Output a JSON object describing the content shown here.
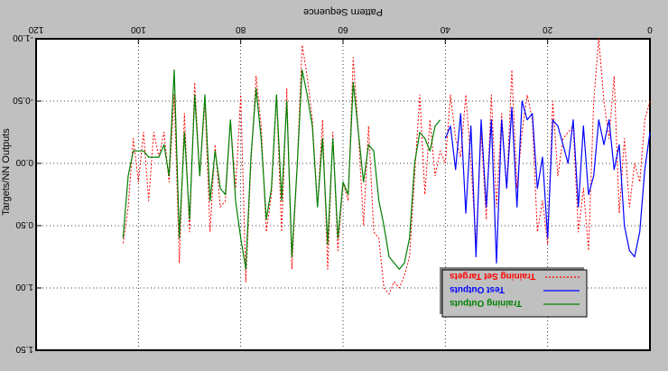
{
  "chart_data": {
    "type": "line",
    "title": "Pattern Sequence",
    "xlabel": "",
    "ylabel": "Targets/NN Outputs",
    "xlim": [
      0,
      120
    ],
    "ylim": [
      -1.0,
      1.5
    ],
    "x_ticks": [
      "0",
      "20",
      "40",
      "60",
      "80",
      "100",
      "120"
    ],
    "y_ticks": [
      "-1.00",
      "-0.50",
      "0.00",
      "0.50",
      "1.00",
      "1.50"
    ],
    "grid": true,
    "legend_position": "bottom-right",
    "legend": [
      {
        "name": "Training Set Targets",
        "color": "#ff0000",
        "style": "dotted"
      },
      {
        "name": "Test Outputs",
        "color": "#0000ff",
        "style": "solid"
      },
      {
        "name": "Training Outputs",
        "color": "#008000",
        "style": "solid"
      }
    ],
    "series": [
      {
        "name": "Training Set Targets",
        "color": "#ff0000",
        "style": "dotted",
        "points": [
          [
            0,
            -0.5
          ],
          [
            1,
            -0.35
          ],
          [
            2,
            0.15
          ],
          [
            3,
            0.0
          ],
          [
            4,
            0.35
          ],
          [
            5,
            -0.2
          ],
          [
            6,
            0.4
          ],
          [
            7,
            -0.7
          ],
          [
            8,
            -0.2
          ],
          [
            9,
            -0.5
          ],
          [
            10,
            -1.0
          ],
          [
            11,
            -0.5
          ],
          [
            12,
            0.7
          ],
          [
            13,
            0.2
          ],
          [
            14,
            0.55
          ],
          [
            15,
            -0.3
          ],
          [
            16,
            -0.25
          ],
          [
            17,
            -0.2
          ],
          [
            18,
            0.1
          ],
          [
            19,
            -0.5
          ],
          [
            20,
            0.65
          ],
          [
            21,
            0.3
          ],
          [
            22,
            0.55
          ],
          [
            23,
            -0.35
          ],
          [
            24,
            -0.55
          ],
          [
            25,
            -0.25
          ],
          [
            26,
            0.2
          ],
          [
            27,
            -0.75
          ],
          [
            28,
            0.2
          ],
          [
            29,
            -0.4
          ],
          [
            30,
            0.35
          ],
          [
            31,
            -0.55
          ],
          [
            32,
            0.45
          ],
          [
            33,
            -0.25
          ],
          [
            34,
            0.65
          ],
          [
            35,
            0.0
          ],
          [
            36,
            -0.55
          ],
          [
            37,
            -0.05
          ],
          [
            38,
            -0.2
          ],
          [
            39,
            -0.55
          ],
          [
            40,
            0.0
          ],
          [
            41,
            -0.1
          ],
          [
            42,
            0.1
          ],
          [
            43,
            -0.35
          ],
          [
            44,
            0.25
          ],
          [
            45,
            -0.55
          ],
          [
            46,
            0.1
          ],
          [
            47,
            0.75
          ],
          [
            48,
            0.9
          ],
          [
            49,
            1.0
          ],
          [
            50,
            0.95
          ],
          [
            51,
            1.05
          ],
          [
            52,
            1.0
          ],
          [
            53,
            0.6
          ],
          [
            54,
            0.55
          ],
          [
            55,
            -0.3
          ],
          [
            56,
            0.5
          ],
          [
            57,
            -0.25
          ],
          [
            58,
            -0.85
          ],
          [
            59,
            0.3
          ],
          [
            60,
            0.15
          ],
          [
            61,
            0.7
          ],
          [
            62,
            -0.25
          ],
          [
            63,
            0.85
          ],
          [
            64,
            -0.35
          ],
          [
            65,
            0.35
          ],
          [
            66,
            -0.35
          ],
          [
            67,
            -0.7
          ],
          [
            68,
            -0.95
          ],
          [
            69,
            0.05
          ],
          [
            70,
            0.85
          ],
          [
            71,
            -0.6
          ],
          [
            72,
            0.55
          ],
          [
            73,
            -0.55
          ],
          [
            74,
            0.25
          ],
          [
            75,
            0.55
          ],
          [
            76,
            -0.3
          ],
          [
            77,
            -0.7
          ],
          [
            78,
            0.0
          ],
          [
            79,
            0.95
          ],
          [
            80,
            -0.55
          ],
          [
            81,
            0.2
          ],
          [
            82,
            -0.35
          ],
          [
            83,
            0.3
          ],
          [
            84,
            0.35
          ],
          [
            85,
            -0.15
          ],
          [
            86,
            0.55
          ],
          [
            87,
            -0.5
          ],
          [
            88,
            0.1
          ],
          [
            89,
            -0.65
          ],
          [
            90,
            0.55
          ],
          [
            91,
            -0.4
          ],
          [
            92,
            0.8
          ],
          [
            93,
            -0.55
          ],
          [
            94,
            0.15
          ],
          [
            95,
            -0.25
          ],
          [
            96,
            -0.05
          ],
          [
            97,
            -0.25
          ],
          [
            98,
            0.3
          ],
          [
            99,
            -0.25
          ],
          [
            100,
            0.15
          ],
          [
            101,
            -0.2
          ],
          [
            102,
            0.35
          ],
          [
            103,
            0.65
          ]
        ]
      },
      {
        "name": "Test Outputs",
        "color": "#0000ff",
        "style": "solid",
        "points": [
          [
            0,
            -0.25
          ],
          [
            1,
            0.05
          ],
          [
            2,
            0.55
          ],
          [
            3,
            0.75
          ],
          [
            4,
            0.7
          ],
          [
            5,
            0.5
          ],
          [
            6,
            -0.15
          ],
          [
            7,
            0.05
          ],
          [
            8,
            -0.35
          ],
          [
            9,
            -0.15
          ],
          [
            10,
            -0.35
          ],
          [
            11,
            0.1
          ],
          [
            12,
            0.25
          ],
          [
            13,
            -0.3
          ],
          [
            14,
            0.35
          ],
          [
            15,
            -0.35
          ],
          [
            16,
            0.0
          ],
          [
            17,
            -0.15
          ],
          [
            18,
            -0.3
          ],
          [
            19,
            -0.35
          ],
          [
            20,
            0.6
          ],
          [
            21,
            -0.05
          ],
          [
            22,
            0.2
          ],
          [
            23,
            -0.4
          ],
          [
            24,
            -0.35
          ],
          [
            25,
            -0.5
          ],
          [
            26,
            0.35
          ],
          [
            27,
            -0.45
          ],
          [
            28,
            0.2
          ],
          [
            29,
            -0.35
          ],
          [
            30,
            0.8
          ],
          [
            31,
            -0.35
          ],
          [
            32,
            0.35
          ],
          [
            33,
            -0.35
          ],
          [
            34,
            0.75
          ],
          [
            35,
            -0.3
          ],
          [
            36,
            0.4
          ],
          [
            37,
            -0.4
          ],
          [
            38,
            0.05
          ],
          [
            39,
            -0.3
          ],
          [
            40,
            -0.2
          ]
        ]
      },
      {
        "name": "Training Outputs",
        "color": "#008000",
        "style": "solid",
        "points": [
          [
            41,
            -0.35
          ],
          [
            42,
            -0.3
          ],
          [
            43,
            -0.1
          ],
          [
            44,
            -0.2
          ],
          [
            45,
            -0.25
          ],
          [
            46,
            0.0
          ],
          [
            47,
            0.6
          ],
          [
            48,
            0.8
          ],
          [
            49,
            0.85
          ],
          [
            50,
            0.8
          ],
          [
            51,
            0.75
          ],
          [
            52,
            0.5
          ],
          [
            53,
            0.3
          ],
          [
            54,
            -0.1
          ],
          [
            55,
            -0.15
          ],
          [
            56,
            0.15
          ],
          [
            57,
            -0.25
          ],
          [
            58,
            -0.65
          ],
          [
            59,
            0.25
          ],
          [
            60,
            0.15
          ],
          [
            61,
            0.6
          ],
          [
            62,
            -0.2
          ],
          [
            63,
            0.65
          ],
          [
            64,
            -0.2
          ],
          [
            65,
            0.35
          ],
          [
            66,
            -0.3
          ],
          [
            67,
            -0.55
          ],
          [
            68,
            -0.75
          ],
          [
            69,
            0.05
          ],
          [
            70,
            0.75
          ],
          [
            71,
            -0.5
          ],
          [
            72,
            0.3
          ],
          [
            73,
            -0.55
          ],
          [
            74,
            0.2
          ],
          [
            75,
            0.45
          ],
          [
            76,
            -0.2
          ],
          [
            77,
            -0.6
          ],
          [
            78,
            -0.05
          ],
          [
            79,
            0.85
          ],
          [
            80,
            0.6
          ],
          [
            81,
            0.3
          ],
          [
            82,
            -0.35
          ],
          [
            83,
            0.25
          ],
          [
            84,
            0.2
          ],
          [
            85,
            -0.1
          ],
          [
            86,
            0.3
          ],
          [
            87,
            -0.55
          ],
          [
            88,
            0.1
          ],
          [
            89,
            -0.55
          ],
          [
            90,
            0.45
          ],
          [
            91,
            -0.25
          ],
          [
            92,
            0.6
          ],
          [
            93,
            -0.75
          ],
          [
            94,
            0.1
          ],
          [
            95,
            -0.15
          ],
          [
            96,
            -0.05
          ],
          [
            97,
            -0.05
          ],
          [
            98,
            -0.05
          ],
          [
            99,
            -0.1
          ],
          [
            100,
            -0.1
          ],
          [
            101,
            -0.1
          ],
          [
            102,
            0.1
          ],
          [
            103,
            0.6
          ]
        ]
      }
    ]
  }
}
